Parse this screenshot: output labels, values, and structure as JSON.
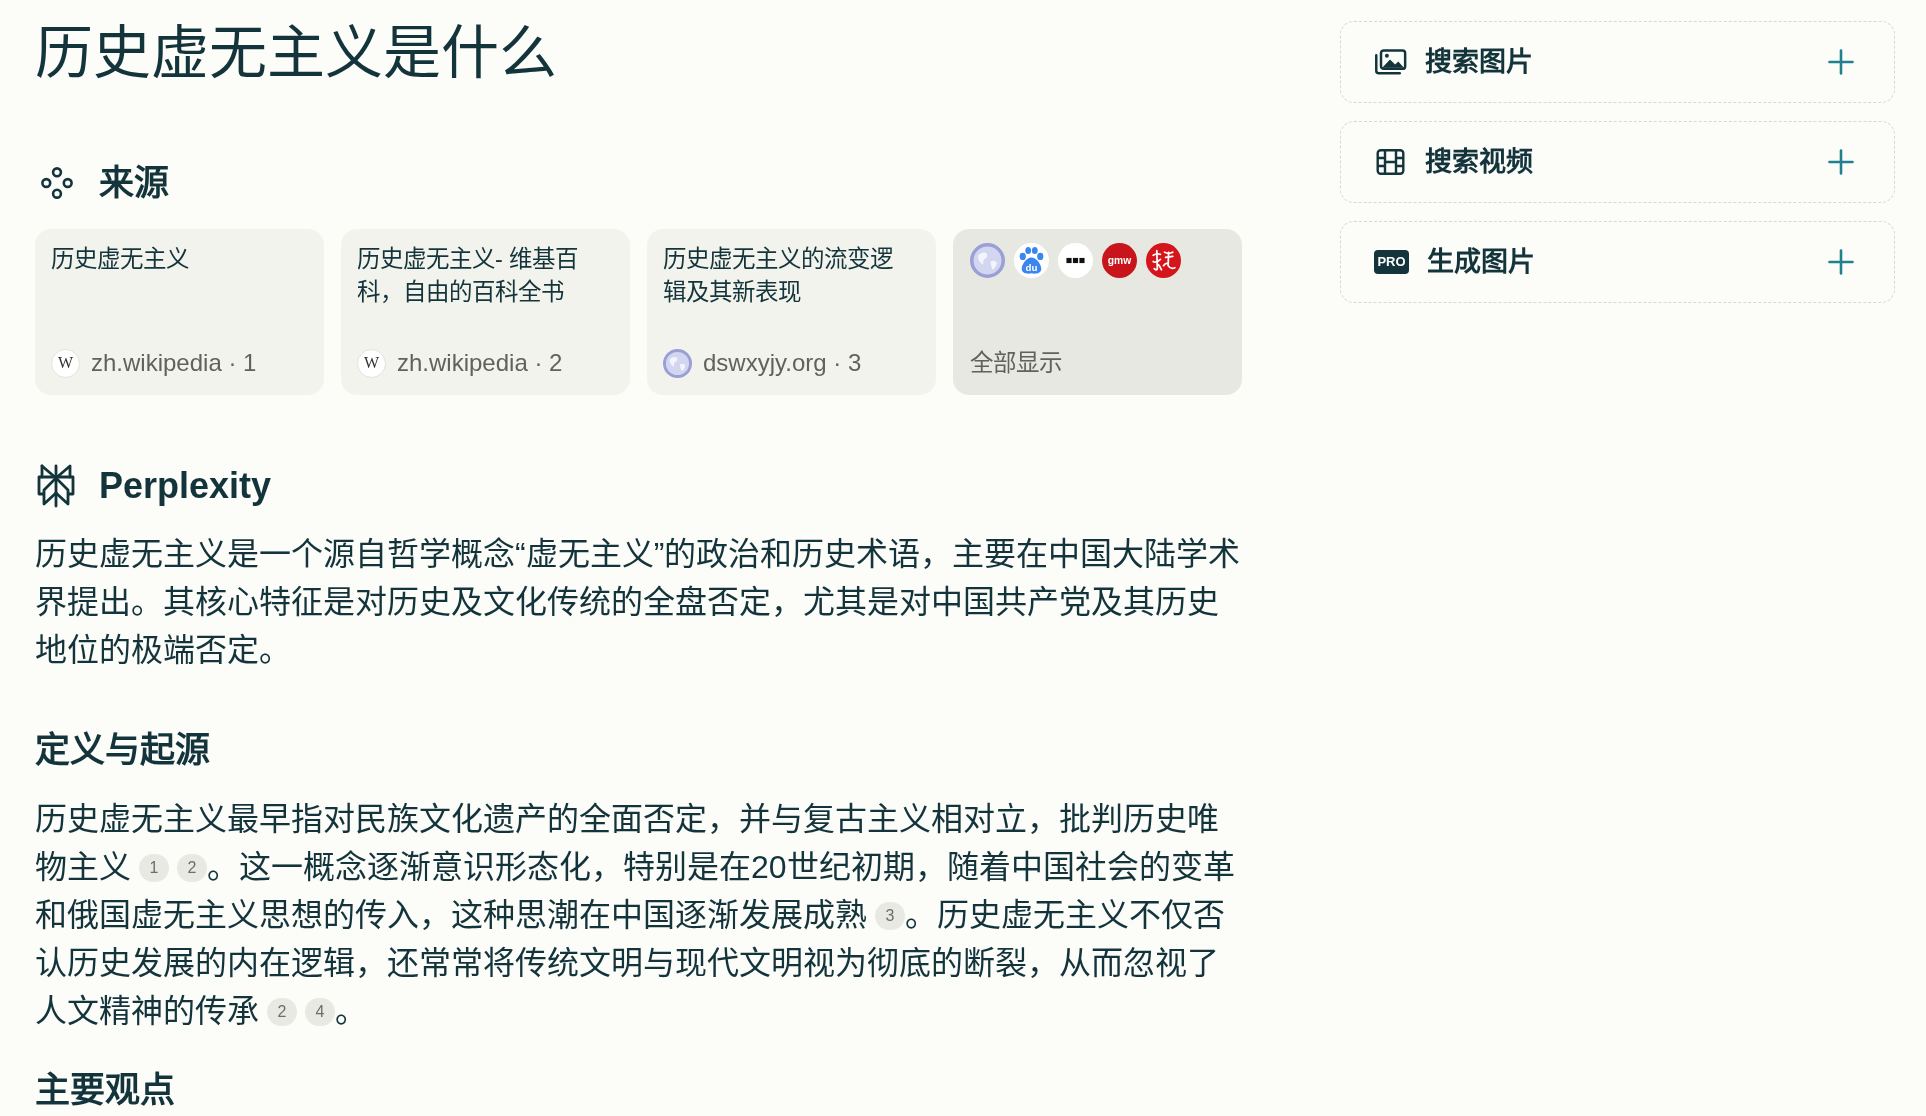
{
  "query_title": "历史虚无主义是什么",
  "sources": {
    "heading": "来源",
    "cards": [
      {
        "kind": "source",
        "title": "历史虚无主义",
        "favicons": [
          {
            "kind": "letter",
            "text": "W"
          }
        ],
        "site": "zh.wikipedia · 1"
      },
      {
        "kind": "source",
        "title": "历史虚无主义- 维基百科，自由的百科全书",
        "favicons": [
          {
            "kind": "letter",
            "text": "W"
          }
        ],
        "site": "zh.wikipedia · 2"
      },
      {
        "kind": "source",
        "title": "历史虚无主义的流变逻辑及其新表现",
        "favicons": [
          {
            "kind": "globe"
          }
        ],
        "site": "dswxyjy.org · 3"
      },
      {
        "kind": "more",
        "favicons": [
          {
            "kind": "globe"
          },
          {
            "kind": "paw",
            "text": "du"
          },
          {
            "kind": "dots"
          },
          {
            "kind": "text_badge",
            "text": "gmw"
          },
          {
            "kind": "brush"
          }
        ],
        "label": "全部显示"
      }
    ]
  },
  "answer": {
    "brand": "Perplexity",
    "blocks": [
      {
        "kind": "paragraph",
        "segments": [
          {
            "kind": "text",
            "text": "历史虚无主义是一个源自哲学概念“虚无主义”的政治和历史术语，主要在中国大陆学术界提出。其核心特征是对历史及文化传统的全盘否定，尤其是对中国共产党及其历史地位的极端否定。"
          }
        ]
      },
      {
        "kind": "heading",
        "text": "定义与起源"
      },
      {
        "kind": "paragraph",
        "segments": [
          {
            "kind": "text",
            "text": "历史虚无主义最早指对民族文化遗产的全面否定，并与复古主义相对立，批判历史唯物主义"
          },
          {
            "kind": "cite",
            "text": "1"
          },
          {
            "kind": "cite",
            "text": "2"
          },
          {
            "kind": "text",
            "text": "。这一概念逐渐意识形态化，特别是在20世纪初期，随着中国社会的变革和俄国虚无主义思想的传入，这种思潮在中国逐渐发展成熟"
          },
          {
            "kind": "cite",
            "text": "3"
          },
          {
            "kind": "text",
            "text": "。历史虚无主义不仅否认历史发展的内在逻辑，还常常将传统文明与现代文明视为彻底的断裂，从而忽视了人文精神的传承"
          },
          {
            "kind": "cite",
            "text": "2"
          },
          {
            "kind": "cite",
            "text": "4"
          },
          {
            "kind": "text",
            "text": "。"
          }
        ]
      },
      {
        "kind": "heading",
        "text": "主要观点"
      }
    ]
  },
  "sidebar": {
    "actions": [
      {
        "kind": "image",
        "label": "搜索图片"
      },
      {
        "kind": "video",
        "label": "搜索视频"
      },
      {
        "kind": "generate",
        "label": "生成图片",
        "badge": "PRO"
      }
    ]
  }
}
